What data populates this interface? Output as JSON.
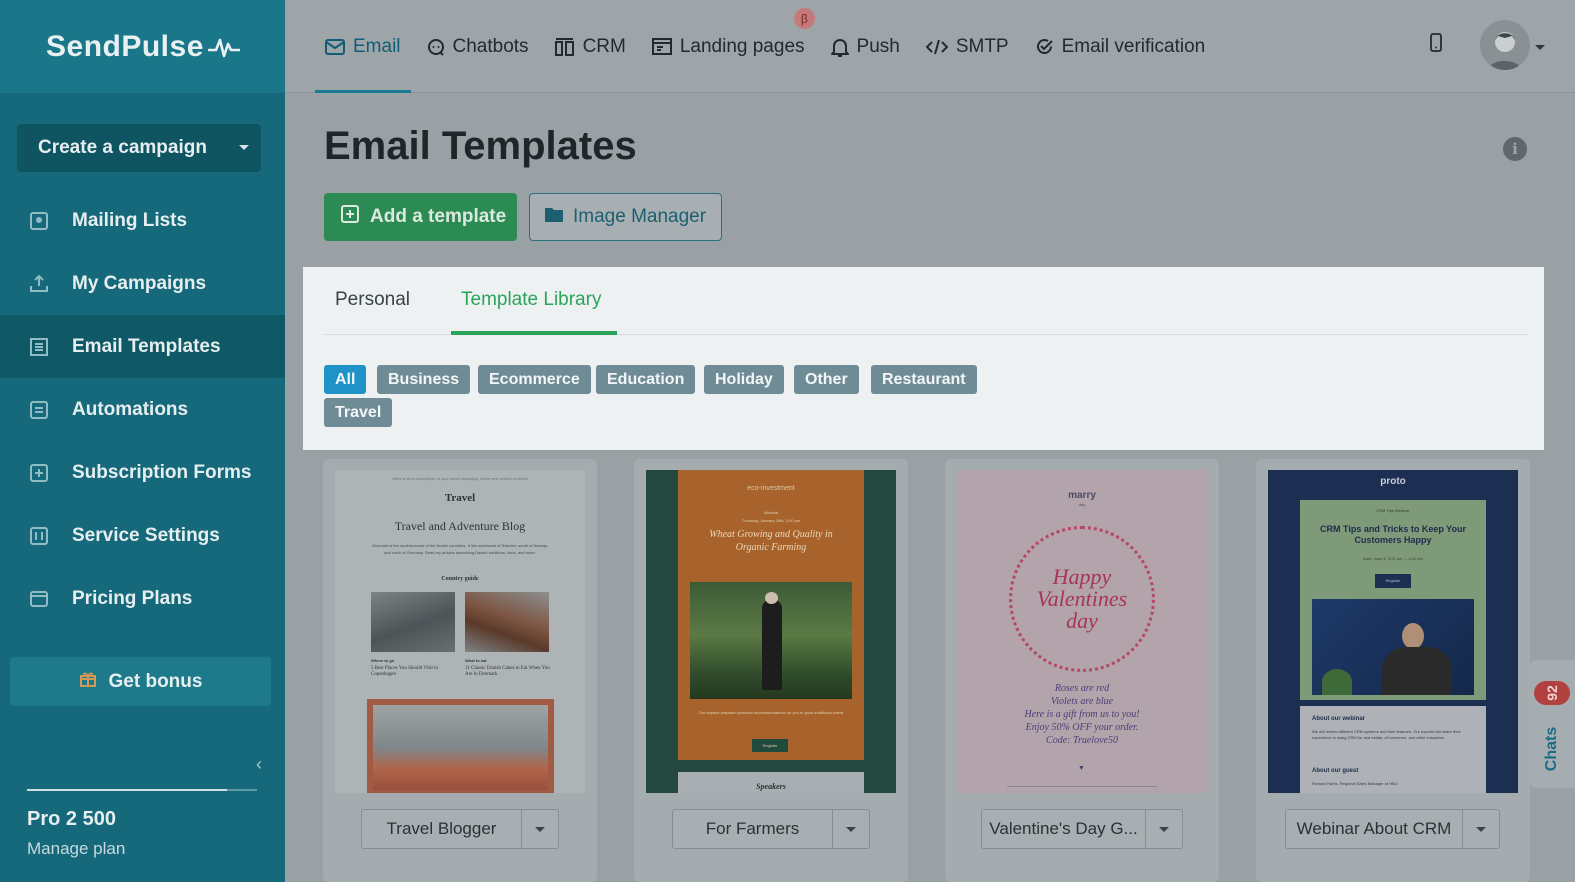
{
  "app": {
    "brand": "SendPulse"
  },
  "sidebar": {
    "create_label": "Create a campaign",
    "items": [
      {
        "label": "Mailing Lists",
        "icon": "address-book-icon"
      },
      {
        "label": "My Campaigns",
        "icon": "send-icon"
      },
      {
        "label": "Email Templates",
        "icon": "template-icon"
      },
      {
        "label": "Automations",
        "icon": "automation-icon"
      },
      {
        "label": "Subscription Forms",
        "icon": "form-icon"
      },
      {
        "label": "Service Settings",
        "icon": "settings-icon"
      },
      {
        "label": "Pricing Plans",
        "icon": "wallet-icon"
      }
    ],
    "active_item": "Email Templates",
    "bonus_label": "Get bonus",
    "plan_name": "Pro 2 500",
    "manage_label": "Manage plan"
  },
  "topnav": {
    "tabs": [
      {
        "label": "Email",
        "icon": "envelope-icon"
      },
      {
        "label": "Chatbots",
        "icon": "chat-icon"
      },
      {
        "label": "CRM",
        "icon": "crm-icon"
      },
      {
        "label": "Landing pages",
        "icon": "landing-icon"
      },
      {
        "label": "Push",
        "icon": "bell-icon"
      },
      {
        "label": "SMTP",
        "icon": "code-icon"
      },
      {
        "label": "Email verification",
        "icon": "check-circle-icon"
      }
    ],
    "active_tab": "Email",
    "beta_badge": "β"
  },
  "main": {
    "title": "Email Templates",
    "add_template_label": "Add a template",
    "image_manager_label": "Image Manager",
    "panel_tabs": [
      "Personal",
      "Template Library"
    ],
    "active_panel_tab": "Template Library",
    "categories": [
      "All",
      "Business",
      "Ecommerce",
      "Education",
      "Holiday",
      "Other",
      "Restaurant",
      "Travel"
    ],
    "active_category": "All",
    "templates": [
      {
        "name": "Travel Blogger",
        "preview": {
          "topline": "Write a short description of your email campaign. Make new version of email",
          "logo": "Travel",
          "title": "Travel and Adventure Blog",
          "body": "Denmark is the southernmost of the Nordic countries. It lies southwest of Sweden, south of Norway, and north of Germany. Read my articles describing Danish traditions, facts, and more.",
          "section": "Country guide",
          "left_caption_title": "Where to go",
          "left_caption": "5 Best Places You Should Visit in Copenhagen",
          "right_caption_title": "What to eat",
          "right_caption": "11 Classic Danish Cakes to Eat When You Are in Denmark"
        }
      },
      {
        "name": "For Farmers",
        "preview": {
          "logo": "eco-investment",
          "subtitle": "Webinar",
          "date": "Thursday, January 26th, 3:00 pm",
          "title": "Wheat Growing and Quality in Organic Farming",
          "body": "Our experts prepared practical recommendations for you to grow traditional wheat",
          "button": "Register",
          "section": "Speakers"
        }
      },
      {
        "name": "Valentine's Day G...",
        "preview": {
          "logo": "marry",
          "logo_sub": "day",
          "headline": "Happy Valentines day",
          "poem_1": "Roses are red",
          "poem_2": "Violets are blue",
          "poem_3": "Here is a gift from us to you!",
          "poem_4": "Enjoy 50% OFF your order.",
          "poem_5": "Code: Truelove50"
        }
      },
      {
        "name": "Webinar About CRM",
        "preview": {
          "logo": "proto",
          "subtitle": "CRM Tips Webinar",
          "title": "CRM Tips and Tricks to Keep Your Customers Happy",
          "date": "Date: June 4, 3:00 pm — 4:00 pm",
          "button": "Register",
          "section_1": "About our webinar",
          "body": "We will review different CRM systems and their features. Our experts will share their experience in using CRM for real estate, eCommerce, and other industries.",
          "section_2": "About our guest",
          "guest": "Richard Harris, Regional Sales Manager at HBO"
        }
      }
    ]
  },
  "chats": {
    "label": "Chats",
    "count": "92"
  },
  "colors": {
    "sidebar": "#15697a",
    "accent_green": "#2ba45b",
    "chip_active": "#1f92c8",
    "overlay_bg": "#9aa1a5"
  }
}
